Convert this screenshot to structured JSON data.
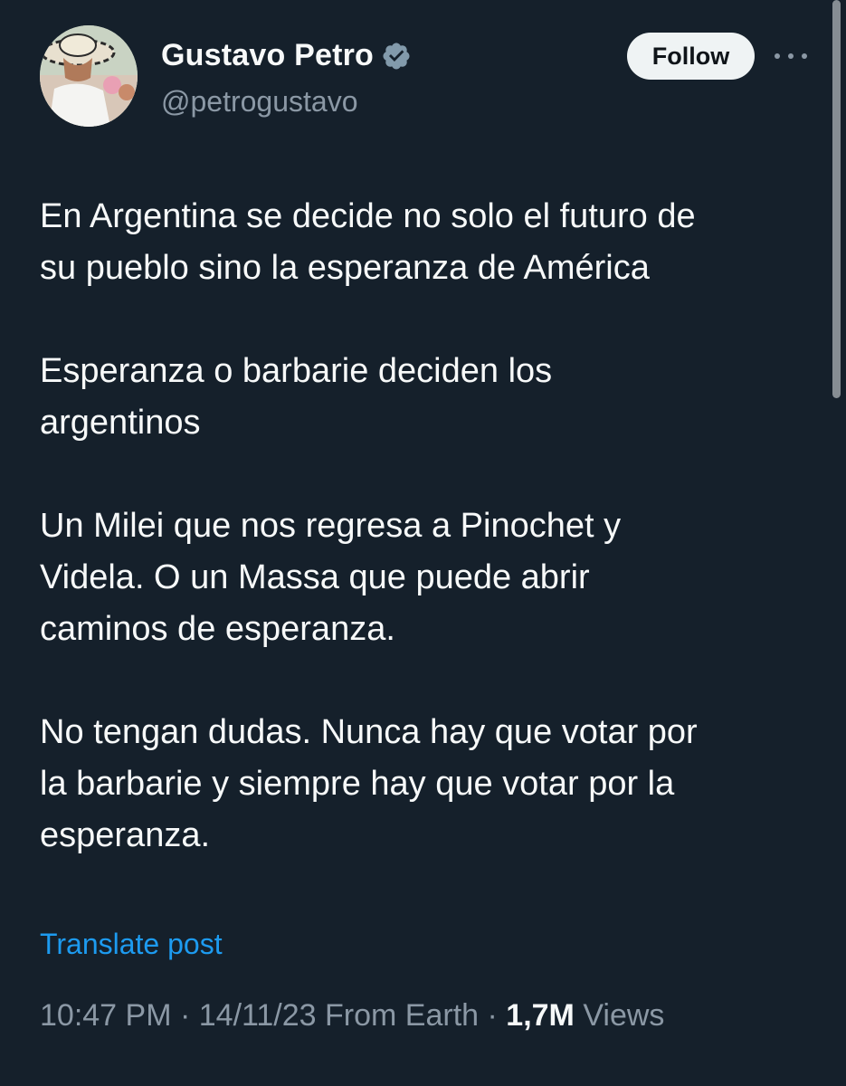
{
  "author": {
    "display_name": "Gustavo Petro",
    "handle": "@petrogustavo",
    "verified": true
  },
  "header": {
    "follow_label": "Follow"
  },
  "tweet": {
    "paragraphs": [
      "En Argentina se decide no solo el futuro de\nsu pueblo sino la esperanza de América",
      "Esperanza o barbarie deciden los\nargentinos",
      "Un Milei que nos regresa a Pinochet y\nVidela. O un Massa que puede abrir\ncaminos de esperanza.",
      "No tengan dudas. Nunca hay que votar por\nla barbarie y siempre hay que votar por la\nesperanza."
    ],
    "translate_label": "Translate post"
  },
  "meta": {
    "time": "10:47 PM",
    "date": "14/11/23",
    "source": "From Earth",
    "views_count": "1,7M",
    "views_label": "Views",
    "separator": " · "
  },
  "colors": {
    "background": "#15202b",
    "text": "#f7f9f9",
    "secondary_text": "#8b98a5",
    "link": "#1d9bf0"
  },
  "icons": {
    "verified": "verified-badge-icon",
    "more": "more-options-icon"
  }
}
